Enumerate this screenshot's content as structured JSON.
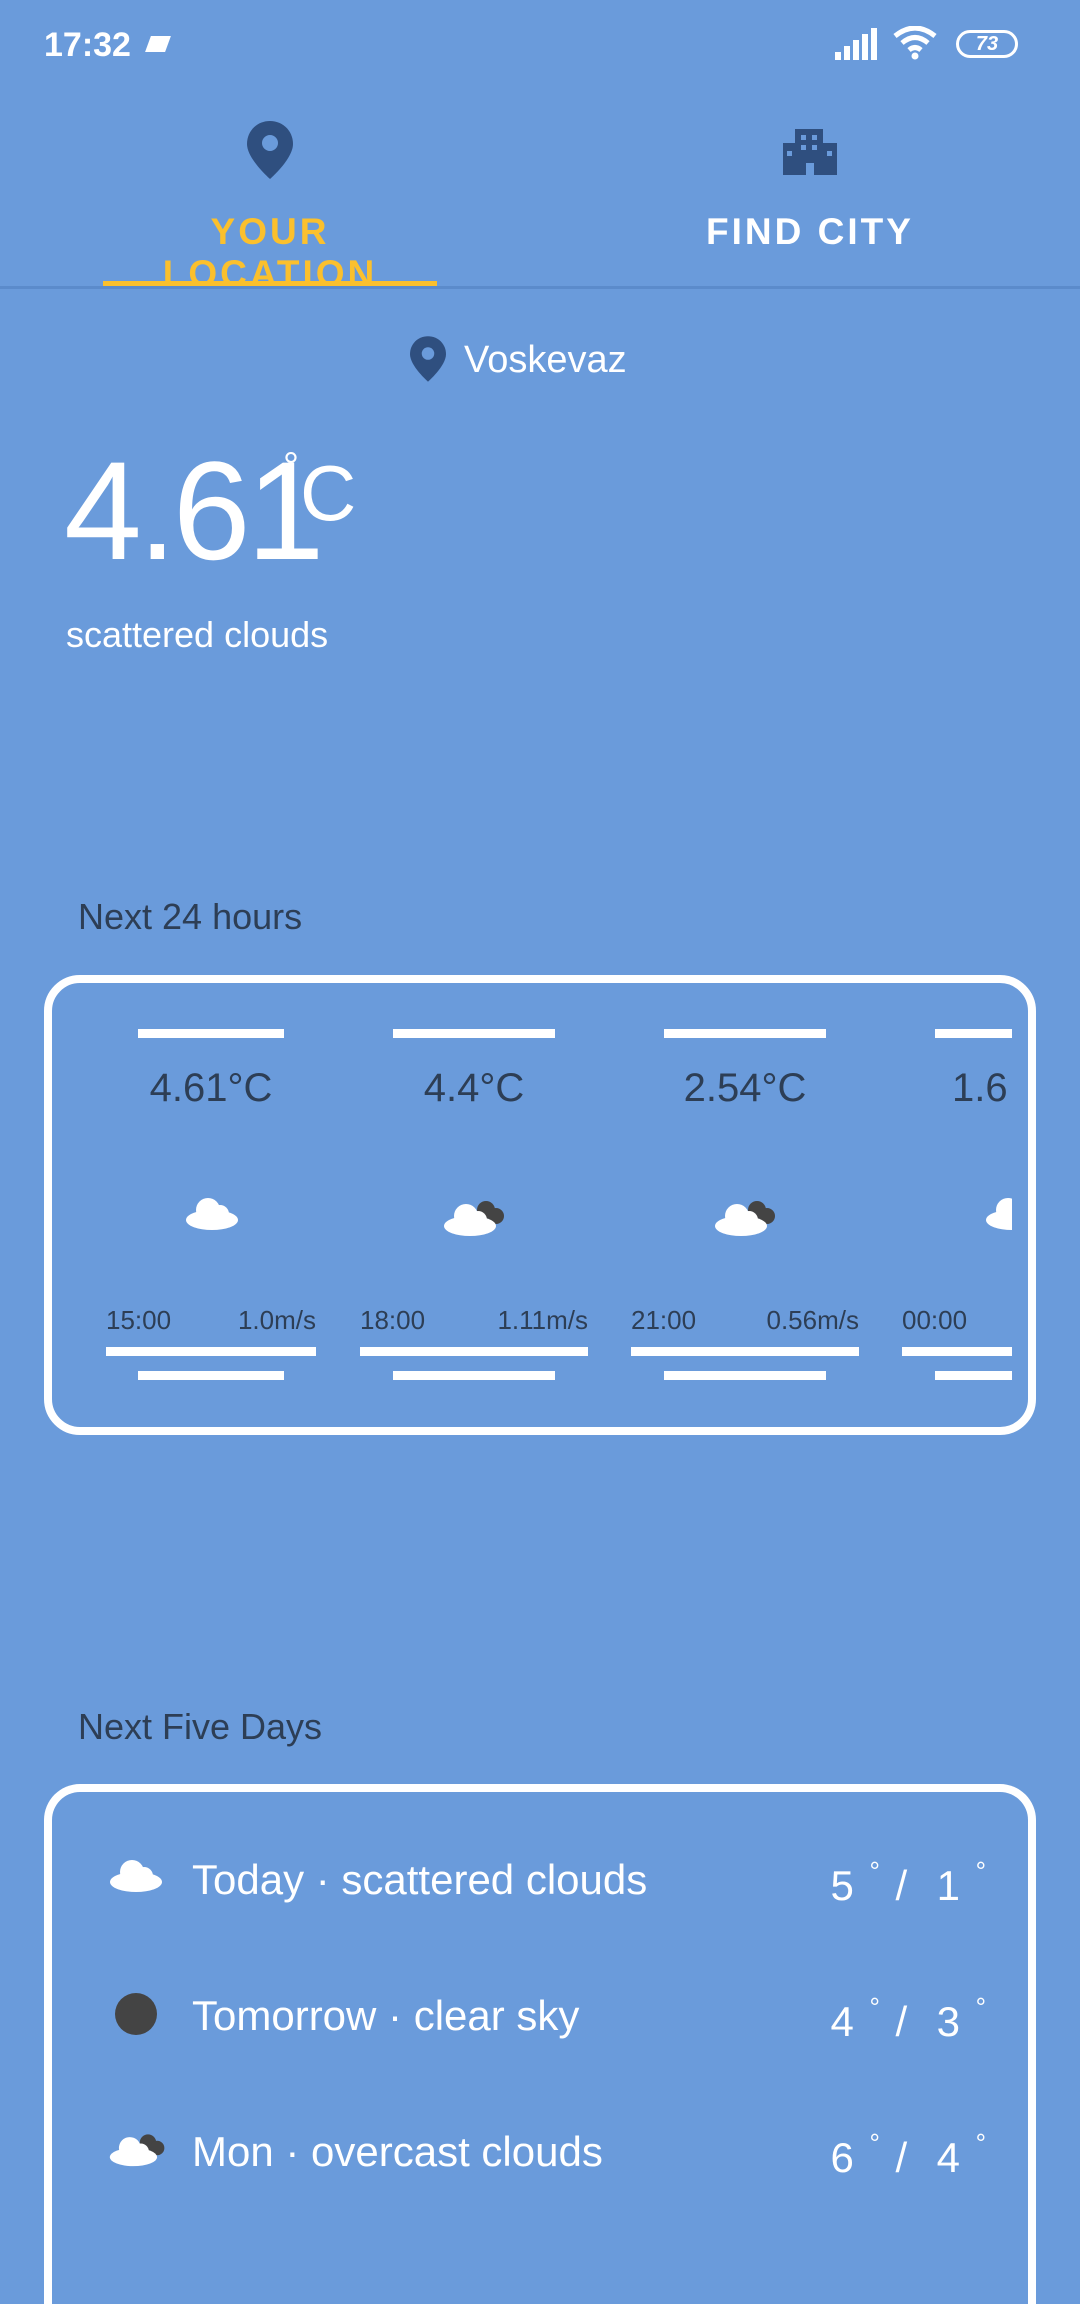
{
  "status_bar": {
    "time": "17:32",
    "battery": "73"
  },
  "tabs": [
    {
      "label": "YOUR LOCATION",
      "icon": "location-pin-icon",
      "active": true,
      "active_color": "#fbc02d"
    },
    {
      "label": "FIND CITY",
      "icon": "city-buildings-icon",
      "active": false
    }
  ],
  "location": {
    "name": "Voskevaz"
  },
  "current": {
    "temperature": "4.61",
    "degree_symbol": "°",
    "unit": "C",
    "description": "scattered clouds"
  },
  "hourly": {
    "title": "Next 24 hours",
    "items": [
      {
        "temp": "4.61°C",
        "icon": "cloud-icon",
        "time": "15:00",
        "wind": "1.0m/s"
      },
      {
        "temp": "4.4°C",
        "icon": "cloud-dark-icon",
        "time": "18:00",
        "wind": "1.11m/s"
      },
      {
        "temp": "2.54°C",
        "icon": "cloud-dark-icon",
        "time": "21:00",
        "wind": "0.56m/s"
      },
      {
        "temp": "1.6",
        "icon": "cloud-icon",
        "time": "00:00",
        "wind": ""
      }
    ]
  },
  "daily": {
    "title": "Next Five Days",
    "items": [
      {
        "label": "Today · scattered clouds",
        "icon": "cloud-icon",
        "high": "5",
        "low": "1"
      },
      {
        "label": "Tomorrow · clear sky",
        "icon": "moon-dark-icon",
        "high": "4",
        "low": "3"
      },
      {
        "label": "Mon · overcast clouds",
        "icon": "cloud-dark-icon",
        "high": "6",
        "low": "4"
      }
    ],
    "degree_symbol": "°",
    "separator": "/"
  },
  "colors": {
    "background": "#6a9bdb",
    "accent": "#fbc02d",
    "dark_text": "#2d3e55",
    "icon_dark": "#2f4f7f"
  }
}
